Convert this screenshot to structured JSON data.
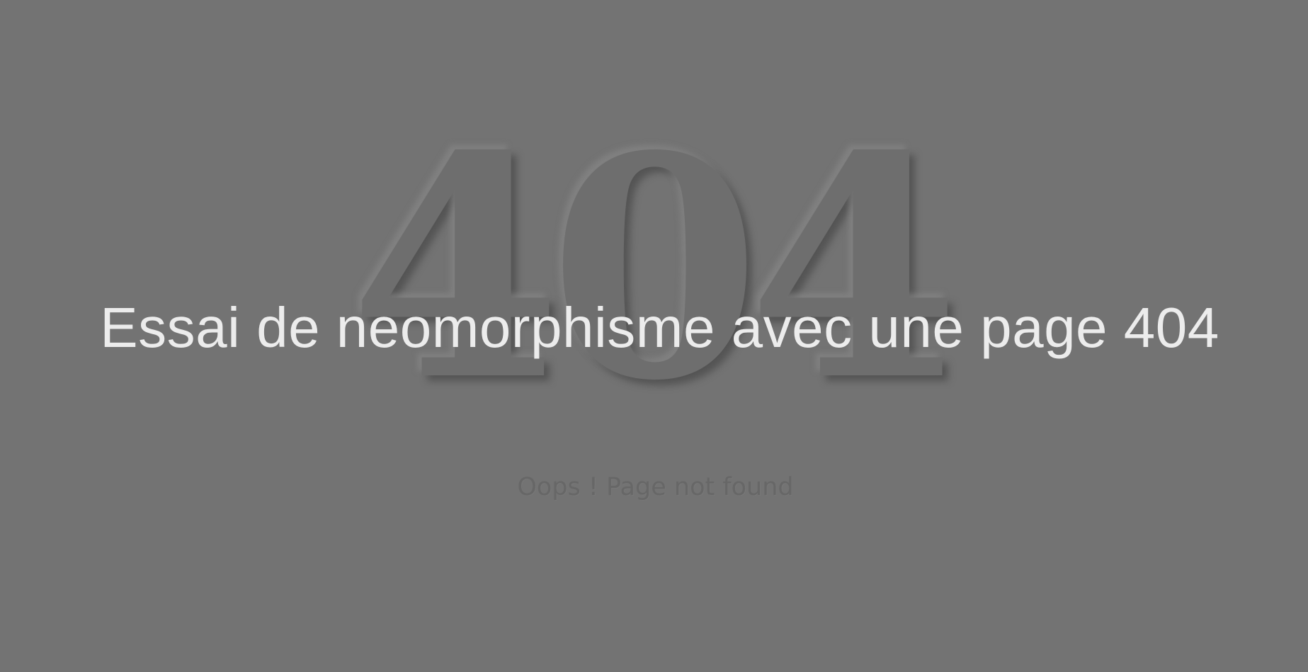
{
  "page": {
    "background_color": "#737373",
    "error_code": "404",
    "headline": "Essai de neomorphisme avec une page 404",
    "message": "Oops ! Page not found"
  }
}
